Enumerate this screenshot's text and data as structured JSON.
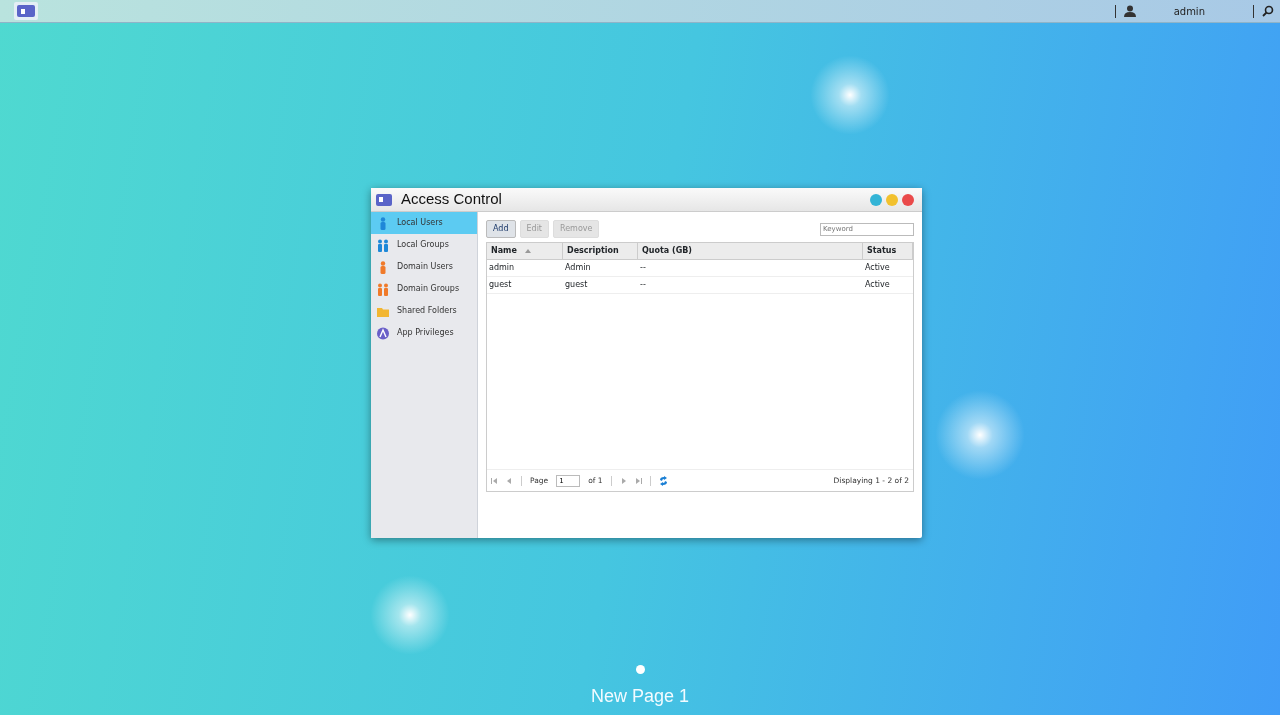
{
  "taskbar": {
    "user": "admin"
  },
  "window": {
    "title": "Access Control",
    "sidebar": {
      "items": [
        {
          "label": "Local Users",
          "kind": "user",
          "color": "#1e88d8",
          "selected": true
        },
        {
          "label": "Local Groups",
          "kind": "group",
          "color": "#1e88d8",
          "selected": false
        },
        {
          "label": "Domain Users",
          "kind": "user",
          "color": "#f07a2a",
          "selected": false
        },
        {
          "label": "Domain Groups",
          "kind": "group",
          "color": "#f07a2a",
          "selected": false
        },
        {
          "label": "Shared Folders",
          "kind": "folder",
          "color": "#f2b632",
          "selected": false
        },
        {
          "label": "App Privileges",
          "kind": "app",
          "color": "#6a5fc8",
          "selected": false
        }
      ]
    },
    "toolbar": {
      "buttons": [
        {
          "label": "Add",
          "disabled": false
        },
        {
          "label": "Edit",
          "disabled": true
        },
        {
          "label": "Remove",
          "disabled": true
        }
      ],
      "search": {
        "placeholder": "Keyword"
      }
    },
    "table": {
      "columns": [
        {
          "label": "Name",
          "sorted": true
        },
        {
          "label": "Description",
          "sorted": false
        },
        {
          "label": "Quota (GB)",
          "sorted": false
        },
        {
          "label": "Status",
          "sorted": false
        }
      ],
      "rows": [
        [
          "admin",
          "Admin",
          "--",
          "Active"
        ],
        [
          "guest",
          "guest",
          "--",
          "Active"
        ]
      ]
    },
    "pager": {
      "page_label": "Page",
      "page_value": "1",
      "of_label": "of 1",
      "summary": "Displaying 1 - 2 of 2"
    }
  },
  "page_title": "New Page 1"
}
